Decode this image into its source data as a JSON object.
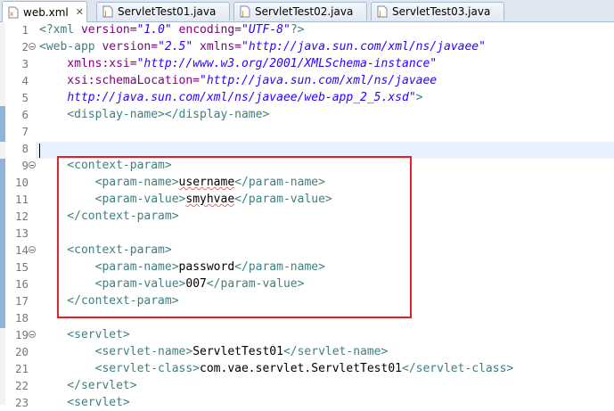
{
  "tabs": [
    {
      "label": "web.xml",
      "icon": "xml-file-icon",
      "active": true,
      "close": "✕"
    },
    {
      "label": "ServletTest01.java",
      "icon": "java-file-icon",
      "active": false
    },
    {
      "label": "ServletTest02.java",
      "icon": "java-file-icon",
      "active": false
    },
    {
      "label": "ServletTest03.java",
      "icon": "java-file-icon",
      "active": false
    }
  ],
  "lines": [
    {
      "n": "1",
      "t": [
        [
          "<?",
          "tg"
        ],
        [
          "xml ",
          "tg"
        ],
        [
          "version=",
          "at"
        ],
        [
          "\"1.0\"",
          "va"
        ],
        [
          " encoding=",
          "at"
        ],
        [
          "\"UTF-8\"",
          "va"
        ],
        [
          "?>",
          "tg"
        ]
      ]
    },
    {
      "n": "2",
      "fold": true,
      "t": [
        [
          "<",
          "tg"
        ],
        [
          "web-app ",
          "tg"
        ],
        [
          "version=",
          "at"
        ],
        [
          "\"2.5\"",
          "va"
        ],
        [
          " xmlns=",
          "at"
        ],
        [
          "\"http://java.sun.com/xml/ns/javaee\"",
          "va"
        ]
      ]
    },
    {
      "n": "3",
      "t": [
        [
          "    xmlns:xsi=",
          "at"
        ],
        [
          "\"http://www.w3.org/2001/XMLSchema-instance\"",
          "va"
        ]
      ]
    },
    {
      "n": "4",
      "t": [
        [
          "    xsi:schemaLocation=",
          "at"
        ],
        [
          "\"http://java.sun.com/xml/ns/javaee",
          "va"
        ]
      ]
    },
    {
      "n": "5",
      "t": [
        [
          "    ",
          "tx"
        ],
        [
          "http://java.sun.com/xml/ns/javaee/web-app_2_5.xsd\"",
          "va"
        ],
        [
          ">",
          "tg"
        ]
      ]
    },
    {
      "n": "6",
      "t": [
        [
          "    <display-name></display-name>",
          "tg"
        ]
      ]
    },
    {
      "n": "7",
      "t": []
    },
    {
      "n": "8",
      "t": []
    },
    {
      "n": "9",
      "fold": true,
      "t": [
        [
          "    <context-param>",
          "tg"
        ]
      ]
    },
    {
      "n": "10",
      "t": [
        [
          "        <param-name>",
          "tg"
        ],
        [
          "username",
          "tx sq"
        ],
        [
          "</param-name>",
          "tg"
        ]
      ]
    },
    {
      "n": "11",
      "t": [
        [
          "        <param-value>",
          "tg"
        ],
        [
          "smyhvae",
          "tx sq"
        ],
        [
          "</param-value>",
          "tg"
        ]
      ]
    },
    {
      "n": "12",
      "t": [
        [
          "    </context-param>",
          "tg"
        ]
      ]
    },
    {
      "n": "13",
      "t": []
    },
    {
      "n": "14",
      "fold": true,
      "t": [
        [
          "    <context-param>",
          "tg"
        ]
      ]
    },
    {
      "n": "15",
      "t": [
        [
          "        <param-name>",
          "tg"
        ],
        [
          "password",
          "tx"
        ],
        [
          "</param-name>",
          "tg"
        ]
      ]
    },
    {
      "n": "16",
      "t": [
        [
          "        <param-value>",
          "tg"
        ],
        [
          "007",
          "tx"
        ],
        [
          "</param-value>",
          "tg"
        ]
      ]
    },
    {
      "n": "17",
      "t": [
        [
          "    </context-param>",
          "tg"
        ]
      ]
    },
    {
      "n": "18",
      "t": []
    },
    {
      "n": "19",
      "fold": true,
      "t": [
        [
          "    <servlet>",
          "tg"
        ]
      ]
    },
    {
      "n": "20",
      "t": [
        [
          "        <servlet-name>",
          "tg"
        ],
        [
          "ServletTest01",
          "tx"
        ],
        [
          "</servlet-name>",
          "tg"
        ]
      ]
    },
    {
      "n": "21",
      "t": [
        [
          "        <servlet-class>",
          "tg"
        ],
        [
          "com.vae.servlet.ServletTest01",
          "tx"
        ],
        [
          "</servlet-class>",
          "tg"
        ]
      ]
    },
    {
      "n": "22",
      "t": [
        [
          "    </servlet>",
          "tg"
        ]
      ]
    },
    {
      "n": "23",
      "t": [
        [
          "    <servlet>",
          "tg"
        ]
      ]
    }
  ]
}
